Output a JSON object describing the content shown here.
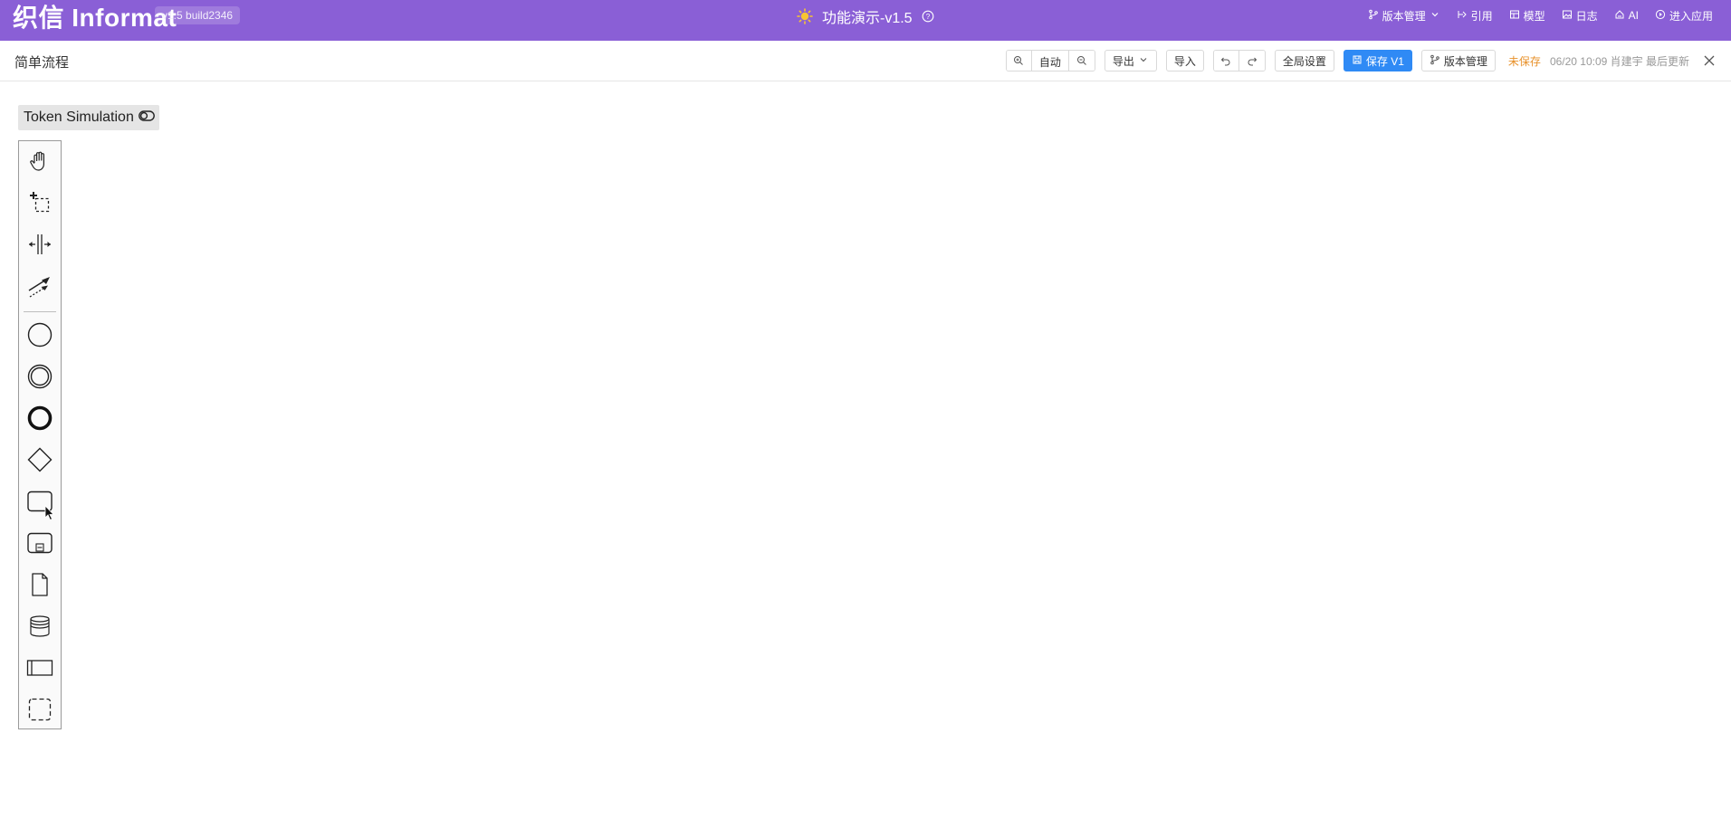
{
  "header": {
    "logo_text": "织信 Informat",
    "version_badge": "v1.5 build2346",
    "app_title": "功能演示-v1.5",
    "links": [
      {
        "label": "版本管理",
        "icon": "branch-icon"
      },
      {
        "label": "引用",
        "icon": "reference-icon"
      },
      {
        "label": "模型",
        "icon": "table-icon"
      },
      {
        "label": "日志",
        "icon": "image-icon"
      },
      {
        "label": "AI",
        "icon": "ai-icon"
      },
      {
        "label": "进入应用",
        "icon": "play-circle-icon"
      }
    ],
    "background_color": "#8a5fd6"
  },
  "toolbar": {
    "page_title": "简单流程",
    "zoom_auto_label": "自动",
    "export_label": "导出",
    "import_label": "导入",
    "global_settings_label": "全局设置",
    "save_label": "保存 V1",
    "version_mgmt_label": "版本管理",
    "unsaved_label": "未保存",
    "meta_text": "06/20 10:09 肖建宇 最后更新",
    "primary_color": "#2f8af5",
    "unsaved_color": "#e8912a"
  },
  "canvas": {
    "token_simulation_label": "Token Simulation",
    "palette": [
      {
        "name": "hand-tool",
        "icon": "hand-icon"
      },
      {
        "name": "lasso-tool",
        "icon": "lasso-icon"
      },
      {
        "name": "space-tool",
        "icon": "space-tool-icon"
      },
      {
        "name": "global-connect-tool",
        "icon": "connect-icon"
      },
      {
        "name": "start-event",
        "icon": "start-event-icon"
      },
      {
        "name": "intermediate-event",
        "icon": "intermediate-event-icon"
      },
      {
        "name": "end-event",
        "icon": "end-event-icon"
      },
      {
        "name": "gateway",
        "icon": "gateway-icon"
      },
      {
        "name": "task",
        "icon": "task-icon"
      },
      {
        "name": "subprocess",
        "icon": "subprocess-icon"
      },
      {
        "name": "data-object",
        "icon": "data-object-icon"
      },
      {
        "name": "data-store",
        "icon": "data-store-icon"
      },
      {
        "name": "participant",
        "icon": "pool-icon"
      },
      {
        "name": "group",
        "icon": "group-icon"
      }
    ]
  }
}
